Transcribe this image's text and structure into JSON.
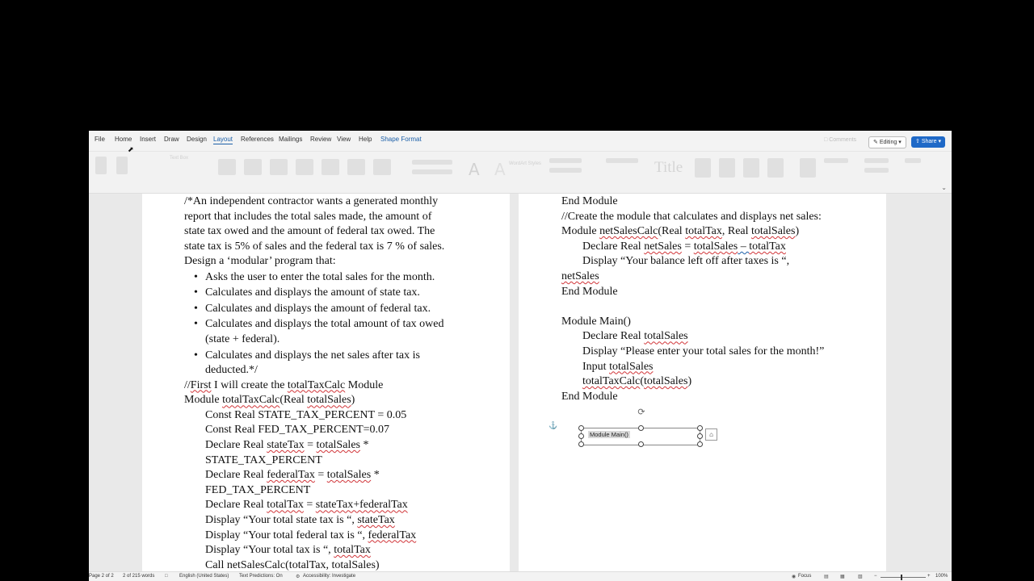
{
  "menubar": {
    "tabs": [
      "File",
      "Home",
      "Insert",
      "Draw",
      "Design",
      "Layout",
      "References",
      "Mailings",
      "Review",
      "View",
      "Help",
      "Shape Format"
    ],
    "comments": "Comments",
    "editing": "Editing",
    "share": "Share"
  },
  "ribbon": {
    "labels": [
      "Text Box",
      "WordArt Styles",
      "Title",
      "A"
    ]
  },
  "document": {
    "left_lines": [
      "/*An independent contractor wants a generated monthly",
      "report that includes the total sales made, the amount of",
      "state tax owed and the amount of federal tax owed. The",
      "state tax is 5% of sales and the federal tax is 7 % of sales.",
      "Design a ‘modular’ program that:"
    ],
    "bullets": [
      "Asks the user to enter the total sales for the month.",
      "Calculates  and displays the amount of state tax.",
      "Calculates and displays the amount of federal tax.",
      "Calculates and displays the total amount of tax owed",
      "(state + federal).",
      "Calculates and displays the net sales after tax is",
      "deducted.*/"
    ],
    "code_a": {
      "first": "First",
      "rest": " I will create the ",
      "name": "totalTaxCalc",
      "tail": " Module"
    },
    "module_line": "Module ",
    "module_name": "totalTaxCalc",
    "module_params": "(Real ",
    "module_param": "totalSales",
    "module_close": ")",
    "code_lines": [
      "Const Real STATE_TAX_PERCENT = 0.05",
      "Const Real FED_TAX_PERCENT=0.07"
    ],
    "decl_state": [
      "Declare Real ",
      "stateTax",
      " = ",
      "totalSales",
      " *"
    ],
    "state_const": "STATE_TAX_PERCENT",
    "decl_fed": [
      "Declare Real ",
      "federalTax",
      " = ",
      "totalSales",
      " *"
    ],
    "fed_const": "FED_TAX_PERCENT",
    "decl_total": [
      "Declare Real ",
      "totalTax",
      " = ",
      "stateTax+federalTax"
    ],
    "disp_state": [
      "Display “Your total state tax is “, ",
      "stateTax"
    ],
    "disp_fed": [
      "Display “Your total federal tax is “, ",
      "federalTax"
    ],
    "disp_total": [
      "Display “Your total tax is “, ",
      "totalTax"
    ],
    "call_line": "Call netSalesCalc(totalTax, totalSales)",
    "right": {
      "end1": "End Module",
      "comment": "//Create the module that calculates and displays net sales:",
      "mod2": [
        "Module ",
        "netSalesCalc",
        "(Real ",
        "totalTax",
        ", Real ",
        "totalSales",
        ")"
      ],
      "decl_net": [
        "Declare Real ",
        "netSales",
        " = ",
        "totalSales",
        " – ",
        "totalTax"
      ],
      "disp_balance": "Display “Your balance left off after taxes is “,",
      "net_sales": "netSales",
      "end2": "End Module",
      "main": "Module Main()",
      "decl_main": [
        "Declare Real ",
        "totalSales"
      ],
      "disp_main": "Display “Please enter your total sales for the month!”",
      "input": [
        "Input ",
        "totalSales"
      ],
      "call_main": [
        "totalTaxCalc",
        "(",
        "totalSales",
        ")"
      ],
      "end3": "End Module"
    },
    "textbox_label": "Module Main()"
  },
  "statusbar": {
    "page": "Page 2 of 2",
    "words": "2 of 215 words",
    "language": "English (United States)",
    "predictions": "Text Predictions: On",
    "accessibility": "Accessibility: Investigate",
    "focus": "Focus",
    "zoom": "100%"
  },
  "colors": {
    "accent": "#1b5fa8",
    "share": "#1f69c7",
    "squiggle": "#d13438"
  }
}
